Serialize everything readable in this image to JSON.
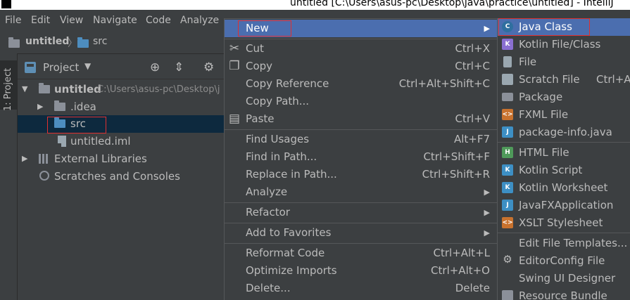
{
  "window": {
    "title": "untitled [C:\\Users\\asus-pc\\Desktop\\java\\practice\\untitled] - IntelliJ"
  },
  "menubar": {
    "items": [
      "File",
      "Edit",
      "View",
      "Navigate",
      "Code",
      "Analyze"
    ]
  },
  "breadcrumb": {
    "project": "untitled",
    "folder": "src"
  },
  "sidebar": {
    "tab_label": "1: Project"
  },
  "project_panel": {
    "title": "Project"
  },
  "tree": {
    "root_label": "untitled",
    "root_path": "C:\\Users\\asus-pc\\Desktop\\j",
    "idea": ".idea",
    "src": "src",
    "iml": "untitled.iml",
    "external_libraries": "External Libraries",
    "scratches": "Scratches and Consoles"
  },
  "context_menu": {
    "new": "New",
    "cut": {
      "label": "Cut",
      "shortcut": "Ctrl+X"
    },
    "copy": {
      "label": "Copy",
      "shortcut": "Ctrl+C"
    },
    "copy_reference": {
      "label": "Copy Reference",
      "shortcut": "Ctrl+Alt+Shift+C"
    },
    "copy_path": {
      "label": "Copy Path..."
    },
    "paste": {
      "label": "Paste",
      "shortcut": "Ctrl+V"
    },
    "find_usages": {
      "label": "Find Usages",
      "shortcut": "Alt+F7"
    },
    "find_in_path": {
      "label": "Find in Path...",
      "shortcut": "Ctrl+Shift+F"
    },
    "replace_in_path": {
      "label": "Replace in Path...",
      "shortcut": "Ctrl+Shift+R"
    },
    "analyze": {
      "label": "Analyze"
    },
    "refactor": {
      "label": "Refactor"
    },
    "add_to_favorites": {
      "label": "Add to Favorites"
    },
    "reformat_code": {
      "label": "Reformat Code",
      "shortcut": "Ctrl+Alt+L"
    },
    "optimize_imports": {
      "label": "Optimize Imports",
      "shortcut": "Ctrl+Alt+O"
    },
    "delete": {
      "label": "Delete...",
      "shortcut": "Delete"
    }
  },
  "new_submenu": {
    "java_class": "Java Class",
    "kotlin_file_class": "Kotlin File/Class",
    "file": "File",
    "scratch_file": {
      "label": "Scratch File",
      "shortcut": "Ctrl+Alt"
    },
    "package": "Package",
    "fxml_file": "FXML File",
    "package_info": "package-info.java",
    "html_file": "HTML File",
    "kotlin_script": "Kotlin Script",
    "kotlin_worksheet": "Kotlin Worksheet",
    "javafx_application": "JavaFXApplication",
    "xslt_stylesheet": "XSLT Stylesheet",
    "edit_file_templates": "Edit File Templates...",
    "editorconfig_file": "EditorConfig File",
    "swing_ui_designer": "Swing UI Designer",
    "resource_bundle": "Resource Bundle"
  },
  "icons": {
    "submenu_arrow": "▶",
    "expanded_arrow": "▼",
    "collapsed_arrow": "▶",
    "dropdown": "▼"
  },
  "colors": {
    "highlight": "#4b6eaf",
    "selection": "#0d293e",
    "annotation": "#e03030",
    "background": "#3c3f41"
  }
}
